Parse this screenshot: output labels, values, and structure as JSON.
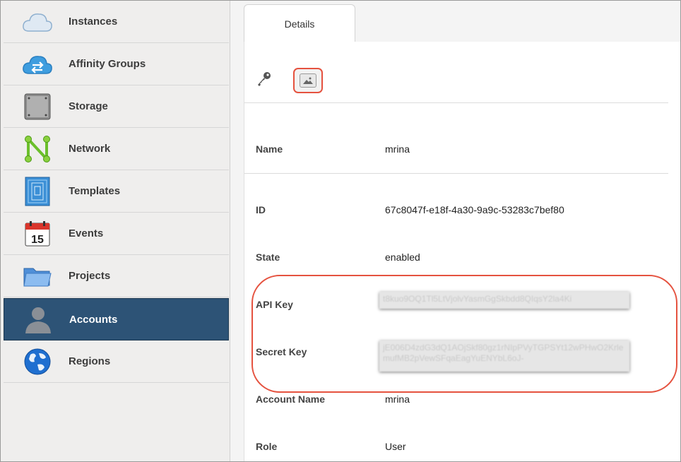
{
  "sidebar": {
    "items": [
      {
        "label": "Instances",
        "icon": "cloud-icon"
      },
      {
        "label": "Affinity Groups",
        "icon": "affinity-cloud-icon"
      },
      {
        "label": "Storage",
        "icon": "storage-icon"
      },
      {
        "label": "Network",
        "icon": "network-icon"
      },
      {
        "label": "Templates",
        "icon": "templates-icon"
      },
      {
        "label": "Events",
        "icon": "calendar-icon",
        "badge": "15"
      },
      {
        "label": "Projects",
        "icon": "folder-icon"
      },
      {
        "label": "Accounts",
        "icon": "user-icon",
        "active": true
      },
      {
        "label": "Regions",
        "icon": "globe-icon"
      }
    ]
  },
  "tabs": {
    "details": "Details"
  },
  "toolbar": {
    "key_icon": "key-icon",
    "image_icon": "image-icon"
  },
  "details": {
    "name": {
      "label": "Name",
      "value": "mrina"
    },
    "id": {
      "label": "ID",
      "value": "67c8047f-e18f-4a30-9a9c-53283c7bef80"
    },
    "state": {
      "label": "State",
      "value": "enabled"
    },
    "api_key": {
      "label": "API Key",
      "value": "t8kuo9OQ1Tl5LtVjolvYasmGgSkbdd8QIqsY2la4Ki"
    },
    "secret_key": {
      "label": "Secret Key",
      "value": "jE006D4zdG3dQ1AOjSkf80gz1rNIpPVyTGPSYt12wPHwO2KrlemufMB2pVewSFqaEagYuENYbL6oJ-"
    },
    "account_name": {
      "label": "Account Name",
      "value": "mrina"
    },
    "role": {
      "label": "Role",
      "value": "User"
    }
  },
  "colors": {
    "active_sidebar": "#2d5376",
    "highlight": "#e5523f"
  }
}
